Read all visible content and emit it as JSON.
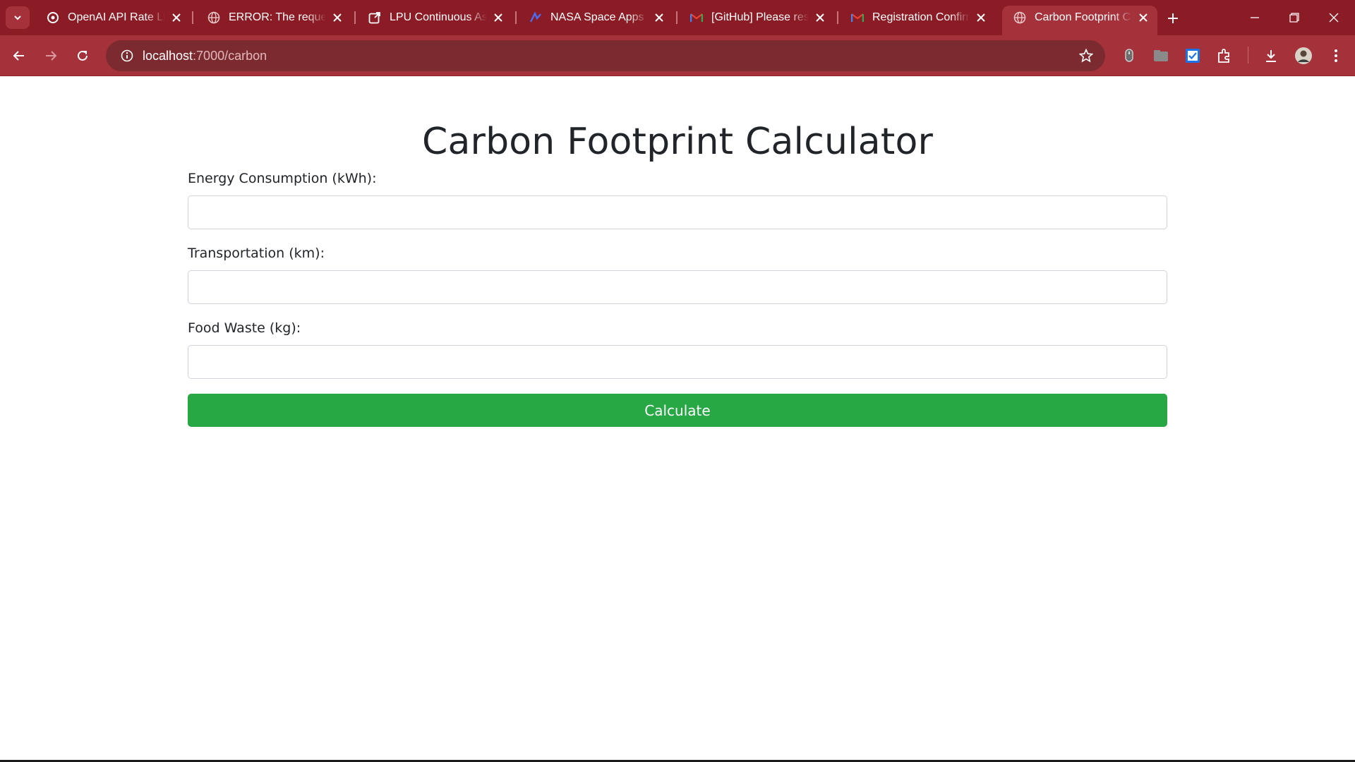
{
  "browser": {
    "tabs": [
      {
        "title": "OpenAI API Rate Lim",
        "favicon": "openai-icon",
        "active": false
      },
      {
        "title": "ERROR: The request c",
        "favicon": "globe-icon",
        "active": false
      },
      {
        "title": "LPU Continuous Asse",
        "favicon": "external-link-icon",
        "active": false
      },
      {
        "title": "NASA Space Apps Ch",
        "favicon": "nasa-icon",
        "active": false
      },
      {
        "title": "[GitHub] Please reset",
        "favicon": "gmail-icon",
        "active": false
      },
      {
        "title": "Registration Confirm",
        "favicon": "gmail-icon",
        "active": false
      },
      {
        "title": "Carbon Footprint Cal",
        "favicon": "globe-icon",
        "active": true
      }
    ],
    "url_host": "localhost",
    "url_rest": ":7000/carbon",
    "colors": {
      "frame": "#8b1c25",
      "toolbar": "#a5313a",
      "omnibox": "#7b2b2f"
    }
  },
  "page": {
    "title": "Carbon Footprint Calculator",
    "fields": [
      {
        "label": "Energy Consumption (kWh):",
        "value": "",
        "placeholder": ""
      },
      {
        "label": "Transportation (km):",
        "value": "",
        "placeholder": ""
      },
      {
        "label": "Food Waste (kg):",
        "value": "",
        "placeholder": ""
      }
    ],
    "submit_label": "Calculate",
    "colors": {
      "button": "#28a745",
      "text": "#212529"
    }
  }
}
